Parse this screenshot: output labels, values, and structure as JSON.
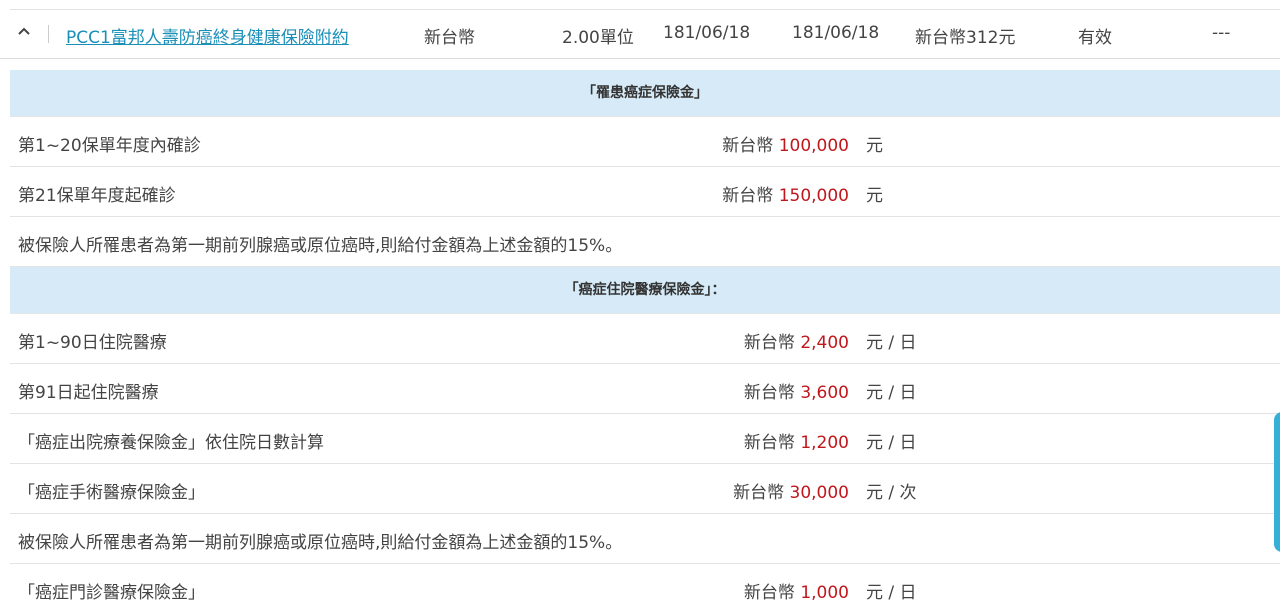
{
  "plan": {
    "name": "PCC1富邦人壽防癌終身健康保險附約",
    "currency": "新台幣",
    "units": "2.00單位",
    "date1": "181/06/18",
    "date2": "181/06/18",
    "premium": "新台幣312元",
    "status": "有效",
    "extra": "---"
  },
  "sections": [
    {
      "title": "「罹患癌症保險金」",
      "rows": [
        {
          "label": "第1~20保單年度內確診",
          "currency": "新台幣",
          "amount": "100,000",
          "unit": "元"
        },
        {
          "label": "第21保單年度起確診",
          "currency": "新台幣",
          "amount": "150,000",
          "unit": "元"
        },
        {
          "label": "被保險人所罹患者為第一期前列腺癌或原位癌時,則給付金額為上述金額的15%。"
        }
      ]
    },
    {
      "title": "「癌症住院醫療保險金」：",
      "rows": [
        {
          "label": "第1~90日住院醫療",
          "currency": "新台幣",
          "amount": "2,400",
          "unit": "元 / 日"
        },
        {
          "label": "第91日起住院醫療",
          "currency": "新台幣",
          "amount": "3,600",
          "unit": "元 / 日"
        },
        {
          "label": "「癌症出院療養保險金」依住院日數計算",
          "currency": "新台幣",
          "amount": "1,200",
          "unit": "元 / 日"
        },
        {
          "label": "「癌症手術醫療保險金」",
          "currency": "新台幣",
          "amount": "30,000",
          "unit": "元 / 次"
        },
        {
          "label": "被保險人所罹患者為第一期前列腺癌或原位癌時,則給付金額為上述金額的15%。"
        },
        {
          "label": "「癌症門診醫療保險金」",
          "currency": "新台幣",
          "amount": "1,000",
          "unit": "元 / 日"
        }
      ]
    }
  ],
  "icons": {
    "collapse": "chevron-up-icon"
  },
  "colors": {
    "accent": "#1a8fb8",
    "amount": "#c0171c",
    "section_bg": "#d6ebf7"
  }
}
